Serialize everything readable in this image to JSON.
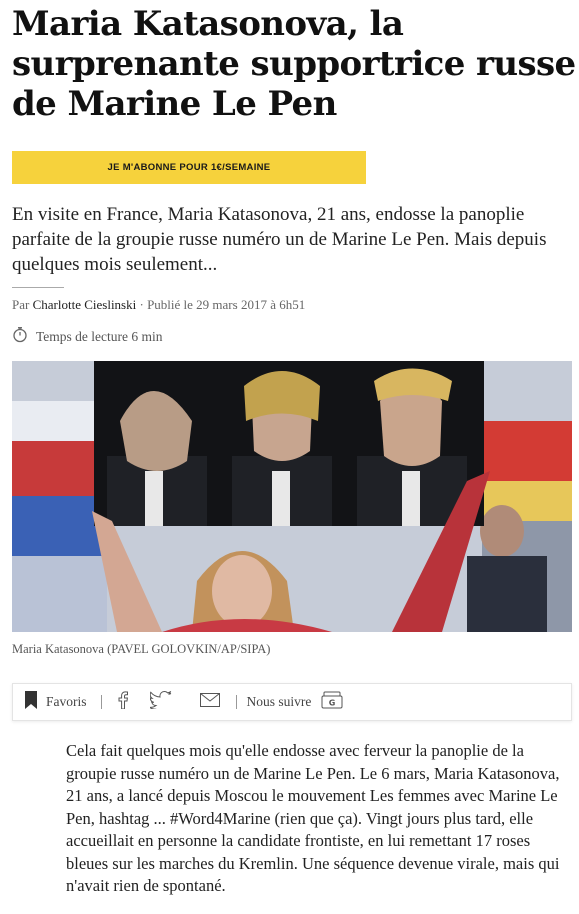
{
  "article": {
    "title": "Maria Katasonova, la surprenante supportrice russe de Marine Le Pen",
    "subscribe_label": "JE M'ABONNE POUR 1€/SEMAINE",
    "lead": "En visite en France, Maria Katasonova, 21 ans, endosse la panoplie parfaite de la groupie russe numéro un de Marine Le Pen. Mais depuis quelques mois seulement...",
    "byline": {
      "prefix": "Par",
      "author": "Charlotte Cieslinski",
      "published": "· Publié le 29 mars 2017 à 6h51"
    },
    "reading_time": "Temps de lecture 6 min",
    "photo_caption": "Maria Katasonova (PAVEL GOLOVKIN/AP/SIPA)",
    "body": "Cela fait quelques mois qu'elle endosse avec ferveur la panoplie de la groupie russe numéro un de Marine Le Pen. Le 6 mars, Maria Katasonova, 21 ans, a lancé depuis Moscou le mouvement Les femmes avec Marine Le Pen, hashtag ... #Word4Marine (rien que ça). Vingt jours plus tard, elle accueillait en personne la candidate frontiste, en lui remettant 17 roses bleues sur les marches du Kremlin. Une séquence devenue virale, mais qui n'avait rien de spontané."
  },
  "sharebar": {
    "favorites_label": "Favoris",
    "follow_label": "Nous suivre",
    "icons": [
      "bookmark-icon",
      "facebook-icon",
      "twitter-icon",
      "mail-icon",
      "google-news-icon"
    ]
  },
  "colors": {
    "subscribe_button": "#f6d23c",
    "text": "#1a1a1a",
    "muted": "#666666"
  }
}
